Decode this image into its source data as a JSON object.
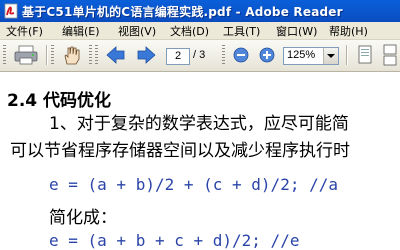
{
  "window": {
    "title": "基于C51单片机的C语言编程实践.pdf - Adobe Reader",
    "icon": "adobe-reader-pdf-icon"
  },
  "menu": [
    "文件(F)",
    "编辑(E)",
    "视图(V)",
    "文档(D)",
    "工具(T)",
    "窗口(W)",
    "帮助(H)"
  ],
  "toolbar": {
    "icons": [
      "print-icon",
      "hand-tool-icon",
      "previous-page-icon",
      "next-page-icon",
      "zoom-out-icon",
      "zoom-in-icon",
      "single-page-icon",
      "continuous-icon"
    ],
    "page_current": "2",
    "page_total": "/ 3",
    "zoom": "125%"
  },
  "document": {
    "heading": "2.4 代码优化",
    "lines": [
      "1、对于复杂的数学表达式，应尽可能简",
      "可以节省程序存储器空间以及减少程序执行时",
      "e = (a + b)/2 + (c + d)/2;      //a",
      "简化成：",
      "e = (a + b + c + d)/2;          //e"
    ]
  },
  "colors": {
    "titlebar": "#0a58d0",
    "menubar": "#ece9d8",
    "code_text": "#2a44a8",
    "nav_arrow": "#3a78d8"
  }
}
